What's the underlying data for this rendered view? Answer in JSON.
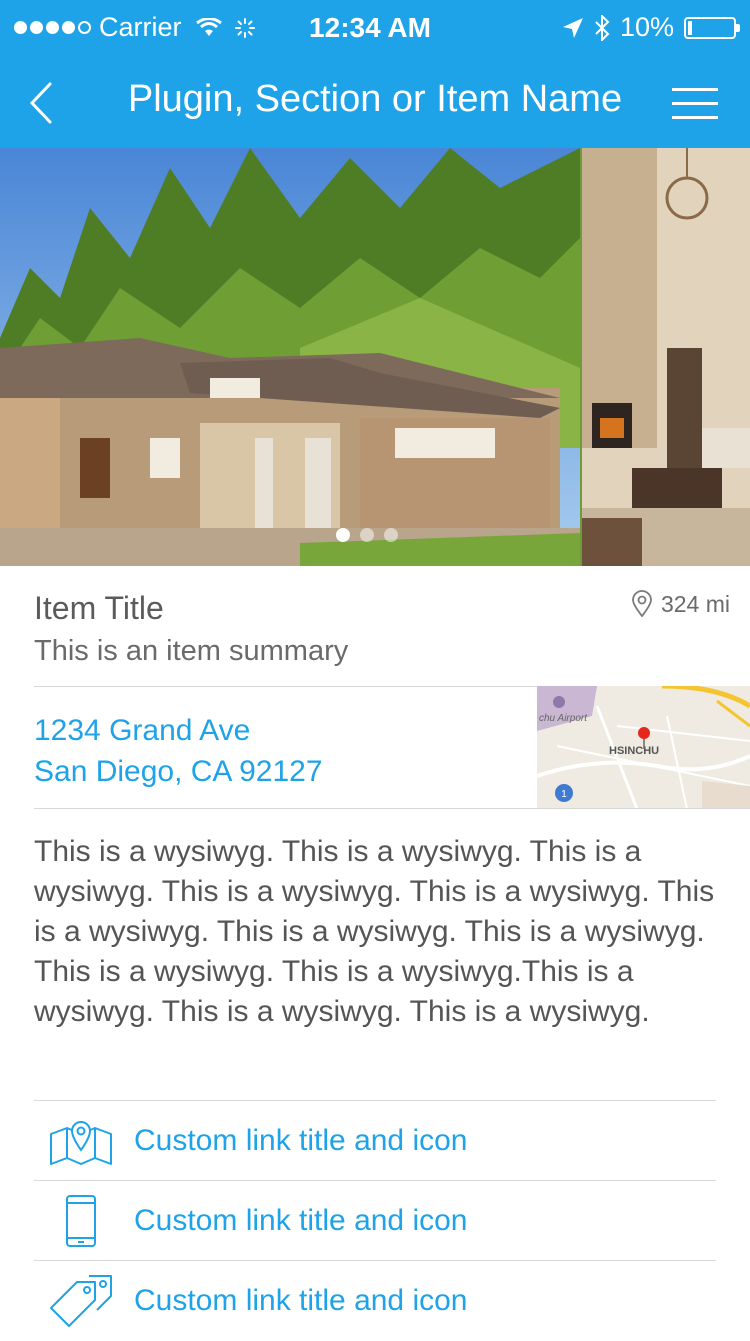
{
  "status_bar": {
    "carrier": "Carrier",
    "time": "12:34 AM",
    "battery": "10%",
    "icons": [
      "signal-dots",
      "wifi-icon",
      "activity-spinner-icon",
      "location-arrow-icon",
      "bluetooth-icon",
      "battery-icon"
    ]
  },
  "nav": {
    "title": "Plugin, Section or Item Name",
    "back_icon": "chevron-left-icon",
    "menu_icon": "hamburger-menu-icon"
  },
  "carousel": {
    "slides": 3,
    "active_index": 0
  },
  "item": {
    "title": "Item Title",
    "summary": "This is an item summary",
    "distance": "324 mi"
  },
  "address": {
    "line1": "1234 Grand Ave",
    "line2": "San Diego, CA 92127"
  },
  "map": {
    "label_airport": "chu Airport",
    "label_city": "HSINCHU",
    "route_number": "1"
  },
  "description": "This is a wysiwyg. This is a wysiwyg. This is a wysiwyg. This is a wysiwyg. This is a wysiwyg. This is a wysiwyg. This is a wysiwyg. This is a wysiwyg. This is a wysiwyg. This is a wysiwyg.This is a wysiwyg. This is a wysiwyg. This is a wysiwyg.",
  "links": [
    {
      "label": "Custom link title and icon",
      "icon": "map-pin-icon"
    },
    {
      "label": "Custom link title and icon",
      "icon": "phone-icon"
    },
    {
      "label": "Custom link title and icon",
      "icon": "tags-icon"
    }
  ],
  "colors": {
    "accent": "#1fa3e8",
    "text": "#555555",
    "divider": "#d8d8d8"
  }
}
